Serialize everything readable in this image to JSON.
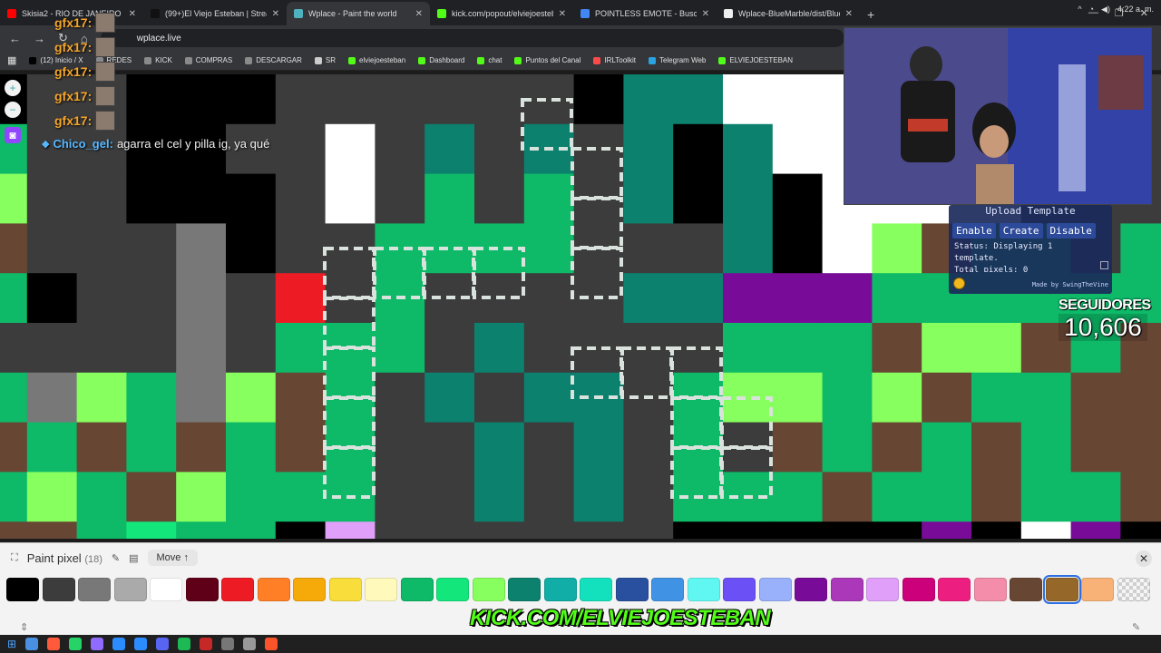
{
  "browser": {
    "tabs": [
      {
        "title": "Skisia2 - RIO DE JANEIRO - You",
        "color": "#ff0000",
        "active": false
      },
      {
        "title": "(99+)El Viejo Esteban | Streame",
        "color": "#111111",
        "active": false
      },
      {
        "title": "Wplace - Paint the world",
        "color": "#4fb3bf",
        "active": true
      },
      {
        "title": "kick.com/popout/elviejoesteba",
        "color": "#53fc18",
        "active": false
      },
      {
        "title": "POINTLESS EMOTE - Buscar cor",
        "color": "#4285f4",
        "active": false
      },
      {
        "title": "Wplace-BlueMarble/dist/BlueM",
        "color": "#eeeeee",
        "active": false
      }
    ],
    "url": "wplace.live",
    "bookmarks": [
      {
        "label": "(12) Inicio / X",
        "color": "#000000"
      },
      {
        "label": "REDES",
        "color": "#8a8a8a"
      },
      {
        "label": "KICK",
        "color": "#8a8a8a"
      },
      {
        "label": "COMPRAS",
        "color": "#8a8a8a"
      },
      {
        "label": "DESCARGAR",
        "color": "#8a8a8a"
      },
      {
        "label": "SR",
        "color": "#cccccc"
      },
      {
        "label": "elviejoesteban",
        "color": "#53fc18"
      },
      {
        "label": "Dashboard",
        "color": "#53fc18"
      },
      {
        "label": "chat",
        "color": "#53fc18"
      },
      {
        "label": "Puntos del Canal",
        "color": "#53fc18"
      },
      {
        "label": "IRLToolkit",
        "color": "#ff4a4a"
      },
      {
        "label": "Telegram Web",
        "color": "#2aa3e0"
      },
      {
        "label": "ELVIEJOESTEBAN",
        "color": "#53fc18"
      }
    ]
  },
  "chat": {
    "repeat_lines": [
      {
        "user": "gfx17:"
      },
      {
        "user": "gfx17:"
      },
      {
        "user": "gfx17:"
      },
      {
        "user": "gfx17:"
      },
      {
        "user": "gfx17:"
      }
    ],
    "message": {
      "user": "Chico_gel:",
      "text": "agarra el cel y pilla ig, ya qué"
    }
  },
  "template_panel": {
    "upload_label": "Upload Template",
    "enable_label": "Enable",
    "create_label": "Create",
    "disable_label": "Disable",
    "status_text": "Status: Displaying 1 template.",
    "total_text": "Total pixels: 0",
    "made_by": "Made by SwingTheVine"
  },
  "followers": {
    "label": "SEGUIDORES",
    "count": "10,606"
  },
  "paint": {
    "title": "Paint pixel",
    "count": "(18)",
    "move_label": "Move",
    "selected_index": 29,
    "palette": [
      "#000000",
      "#3c3c3c",
      "#787878",
      "#aaaaaa",
      "#ffffff",
      "#600018",
      "#ed1c24",
      "#ff7f27",
      "#f6aa09",
      "#f9dd3b",
      "#fffabc",
      "#0eb968",
      "#13e67b",
      "#87ff5e",
      "#0c816e",
      "#10aea6",
      "#13e1be",
      "#28509e",
      "#4093e4",
      "#60f7f2",
      "#6b50f6",
      "#99b1fb",
      "#780c99",
      "#aa38b9",
      "#e09ff9",
      "#cb007a",
      "#ec1f80",
      "#f38da9",
      "#684634",
      "#95682a",
      "#f8b277",
      "transparent"
    ]
  },
  "kick_banner": "KICK.COM/ELVIEJOESTEBAN",
  "taskbar": {
    "time": "4:22 a. m.",
    "apps": [
      "#4a90e2",
      "#ff5a3c",
      "#25d366",
      "#8f6bff",
      "#2b8cff",
      "#2b8cff",
      "#5865f2",
      "#1db954",
      "#c62828",
      "#777777",
      "#999999",
      "#fb542b"
    ]
  },
  "canvas": {
    "palette": {
      "B": "#000000",
      "D": "#3c3c3c",
      "G": "#787878",
      "W": "#ffffff",
      "R": "#ed1c24",
      "g": "#0eb968",
      "l": "#87ff5e",
      "t": "#0c816e",
      "b": "#684634",
      "P": "#780c99",
      "p": "#e09ff9",
      "e": "#13e67b"
    }
  }
}
